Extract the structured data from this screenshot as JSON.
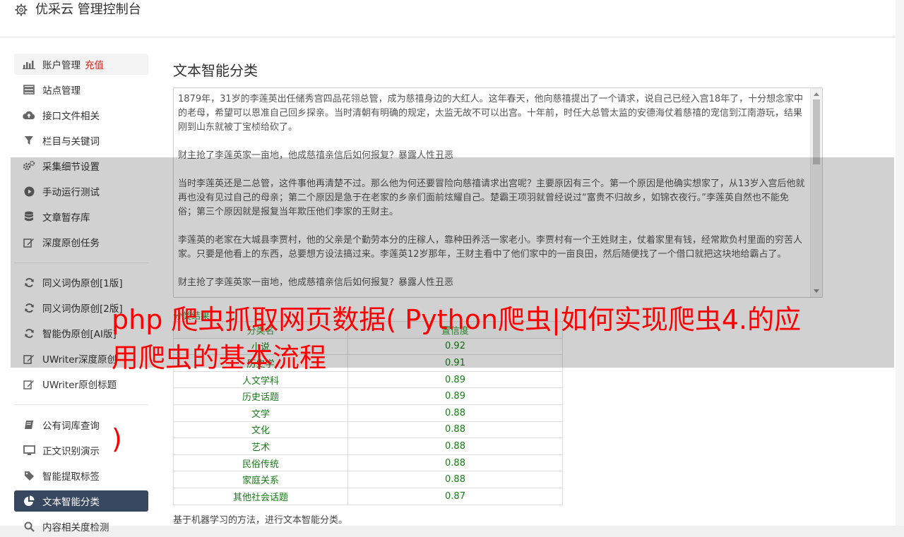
{
  "header": {
    "brand": "优采云 管理控制台",
    "icon": "gear-icon"
  },
  "sidebar": {
    "items": [
      {
        "label": "账户管理",
        "extra": "充值",
        "icon": "bar-chart-icon"
      },
      {
        "label": "站点管理",
        "icon": "server-icon"
      },
      {
        "label": "接口文件相关",
        "icon": "cloud-upload-icon"
      },
      {
        "label": "栏目与关键词",
        "icon": "filter-icon"
      },
      {
        "label": "采集细节设置",
        "icon": "gears-icon"
      },
      {
        "label": "手动运行测试",
        "icon": "play-circle-icon"
      },
      {
        "label": "文章暂存库",
        "icon": "database-icon"
      },
      {
        "label": "深度原创任务",
        "icon": "edit-icon"
      },
      {
        "label": "同义词伪原创[1版]",
        "icon": "refresh-icon"
      },
      {
        "label": "同义词伪原创[2版]",
        "icon": "refresh-icon"
      },
      {
        "label": "智能伪原创[AI版]",
        "icon": "refresh-icon"
      },
      {
        "label": "UWriter深度原创",
        "icon": "edit-icon"
      },
      {
        "label": "UWriter原创标题",
        "icon": "edit-icon"
      },
      {
        "label": "公有词库查询",
        "icon": "book-icon"
      },
      {
        "label": "正文识别演示",
        "icon": "monitor-icon"
      },
      {
        "label": "智能提取标签",
        "icon": "tag-icon"
      },
      {
        "label": "文本智能分类",
        "icon": "pie-chart-icon"
      },
      {
        "label": "内容相关度检测",
        "icon": "search-icon"
      }
    ]
  },
  "main": {
    "title": "文本智能分类",
    "text_paragraphs": [
      "1879年，31岁的李莲英出任储秀宫四品花翎总管，成为慈禧身边的大红人。这年春天，他向慈禧提出了一个请求，说自己已经入宫18年了，十分想念家中的老母，希望可以恩准自己回乡探亲。当时清朝有明确的规定，太监无故不可以出宫。十年前，时任大总管太监的安德海仗着慈禧的宠信到江南游玩，结果刚到山东就被丁宝桢给砍了。",
      "财主抢了李莲英家一亩地，他成慈禧亲信后如何报复？暴露人性丑恶",
      "当时李莲英还是二总管，这件事他再清楚不过。那么他为何还要冒险向慈禧请求出宫呢？主要原因有三个。第一个原因是他确实想家了，从13岁入宫后他就再也没有见过自己的母亲；第二个原因是急于在老家的乡亲们面前炫耀自己。楚霸王项羽就曾经说过“富贵不归故乡，如锦衣夜行。”李莲英自然也不能免俗；第三个原因就是报复当年欺压他们李家的王财主。",
      "李莲英的老家在大城县李贾村，他的父亲是个勤劳本分的庄稼人，靠种田养活一家老小。李贾村有一个王姓财主，仗着家里有钱，经常欺负村里面的穷苦人家。只要是他看上的东西，总要想方设法搞过来。李莲英12岁那年，王财主看中了他们家中的一亩良田，然后随便找了一个借口就把这块地给霸占了。",
      "财主抢了李莲英家一亩地，他成慈禧亲信后如何报复？暴露人性丑恶"
    ],
    "result_label": "分类结果",
    "table": {
      "headers": [
        "分类名",
        "置信度"
      ],
      "rows": [
        [
          "小说",
          "0.92"
        ],
        [
          "历史学",
          "0.91"
        ],
        [
          "人文学科",
          "0.89"
        ],
        [
          "历史话题",
          "0.89"
        ],
        [
          "文学",
          "0.88"
        ],
        [
          "文化",
          "0.88"
        ],
        [
          "艺术",
          "0.88"
        ],
        [
          "民俗传统",
          "0.88"
        ],
        [
          "家庭关系",
          "0.88"
        ],
        [
          "其他社会话题",
          "0.87"
        ]
      ]
    },
    "footnote": "基于机器学习的方法，进行文本智能分类。"
  },
  "overlay": {
    "title": "php 爬虫抓取网页数据( Python爬虫|如何实现爬虫4.的应用爬虫的基本流程",
    "paren": ")"
  },
  "colors": {
    "active_bg": "#37475f",
    "recharge": "#d9251c",
    "result_green": "#1a7a1a",
    "overlay_red": "#ff0000"
  }
}
